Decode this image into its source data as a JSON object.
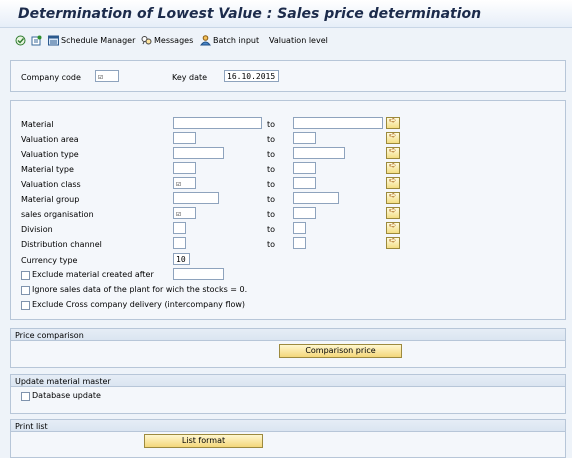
{
  "window": {
    "title": "Determination of Lowest Value : Sales price determination"
  },
  "toolbar": {
    "items": [
      {
        "label": "",
        "icon": "execute-icon"
      },
      {
        "label": "",
        "icon": "variant-icon"
      },
      {
        "label": "Schedule Manager",
        "icon": "schedule-manager-icon"
      },
      {
        "label": "Messages",
        "icon": "messages-icon"
      },
      {
        "label": "Batch input",
        "icon": "batch-input-icon"
      },
      {
        "label": "Valuation level",
        "icon": ""
      }
    ]
  },
  "header": {
    "company_code_label": "Company code",
    "company_code_value": "☑",
    "key_date_label": "Key date",
    "key_date_value": "16.10.2015"
  },
  "selection": {
    "to_label": "to",
    "rows": [
      {
        "label": "Material",
        "from": "",
        "to": ""
      },
      {
        "label": "Valuation area",
        "from": "",
        "to": ""
      },
      {
        "label": "Valuation type",
        "from": "",
        "to": ""
      },
      {
        "label": "Material type",
        "from": "",
        "to": ""
      },
      {
        "label": "Valuation class",
        "from": "☑",
        "to": ""
      },
      {
        "label": "Material group",
        "from": "",
        "to": ""
      },
      {
        "label": "sales organisation",
        "from": "☑",
        "to": ""
      },
      {
        "label": "Division",
        "from": "",
        "to": ""
      },
      {
        "label": "Distribution channel",
        "from": "",
        "to": ""
      }
    ],
    "currency_type_label": "Currency type",
    "currency_type_value": "10",
    "exclude_created_label": "Exclude  material created after",
    "exclude_created_value": "",
    "ignore_sales_label": "Ignore sales data of the plant for wich the stocks = 0.",
    "exclude_cross_label": "Exclude Cross company delivery  (intercompany flow)"
  },
  "price_comparison": {
    "title": "Price comparison",
    "button": "Comparison price"
  },
  "update_master": {
    "title": "Update material master",
    "checkbox": "Database update"
  },
  "print_list": {
    "title": "Print list",
    "button": "List format"
  },
  "colors": {
    "title_text": "#1c2b4b",
    "button_fill": "#f4d77a",
    "frame_border": "#b7c6d8"
  }
}
